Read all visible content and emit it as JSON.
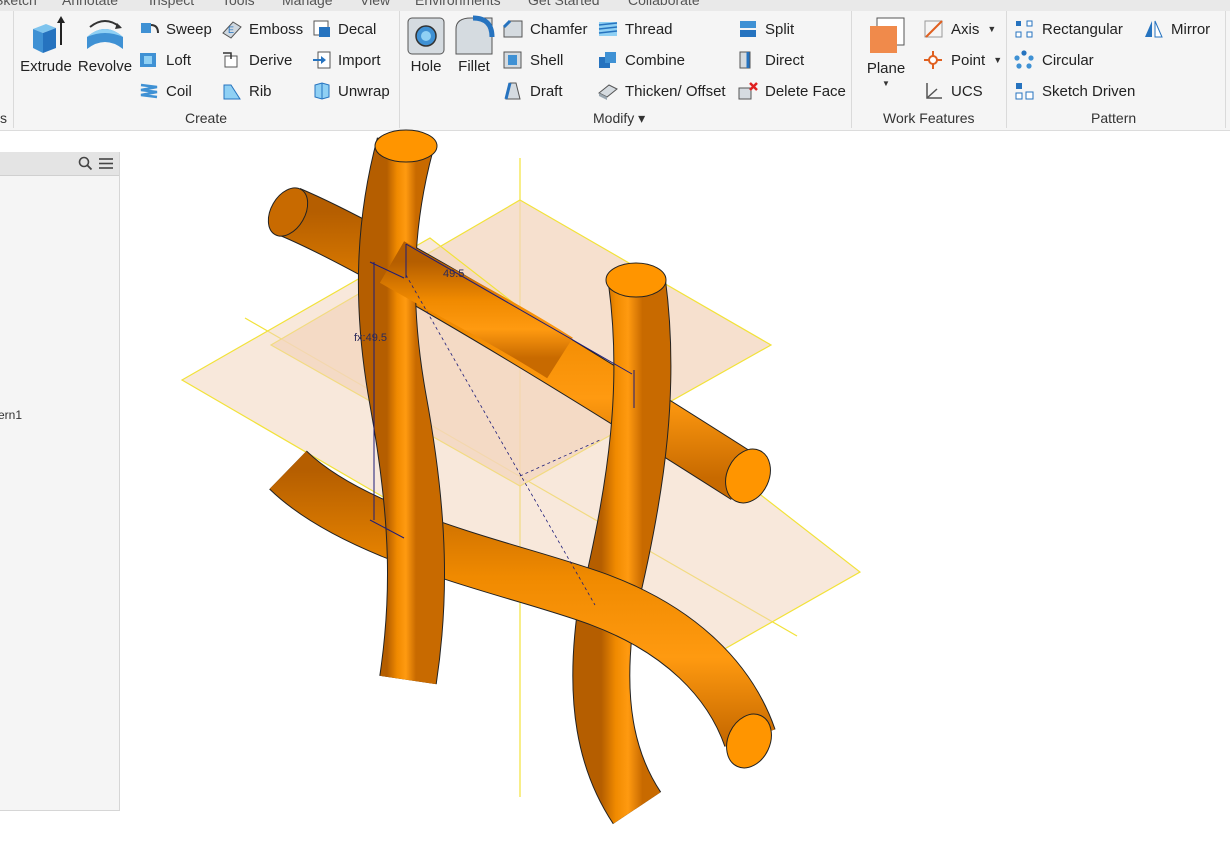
{
  "tabs": [
    "Sketch",
    "Annotate",
    "Inspect",
    "Tools",
    "Manage",
    "View",
    "Environments",
    "Get Started",
    "Collaborate"
  ],
  "ribbon": {
    "prev_panel_label": "s",
    "create": {
      "label": "Create",
      "extrude": "Extrude",
      "revolve": "Revolve",
      "sweep": "Sweep",
      "loft": "Loft",
      "coil": "Coil",
      "emboss": "Emboss",
      "derive": "Derive",
      "rib": "Rib",
      "decal": "Decal",
      "import": "Import",
      "unwrap": "Unwrap"
    },
    "modify": {
      "label": "Modify ▾",
      "hole": "Hole",
      "fillet": "Fillet",
      "chamfer": "Chamfer",
      "shell": "Shell",
      "draft": "Draft",
      "thread": "Thread",
      "combine": "Combine",
      "thicken": "Thicken/ Offset",
      "split": "Split",
      "direct": "Direct",
      "delete_face": "Delete Face"
    },
    "work_features": {
      "label": "Work Features",
      "plane": "Plane",
      "axis": "Axis",
      "point": "Point",
      "ucs": "UCS"
    },
    "pattern": {
      "label": "Pattern",
      "rectangular": "Rectangular",
      "circular": "Circular",
      "sketch_driven": "Sketch Driven",
      "mirror": "Mirror"
    }
  },
  "browser": {
    "search_icon": "search-icon",
    "menu_icon": "menu-icon",
    "item_text": "ern1"
  },
  "viewport": {
    "dim_horizontal": "49.5",
    "dim_vertical": "fx:49.5"
  },
  "colors": {
    "tube": "#f08a00",
    "plane_fill": "#f3d6bd",
    "work_axis": "#f2e23a",
    "dimension": "#1c1c7a"
  }
}
